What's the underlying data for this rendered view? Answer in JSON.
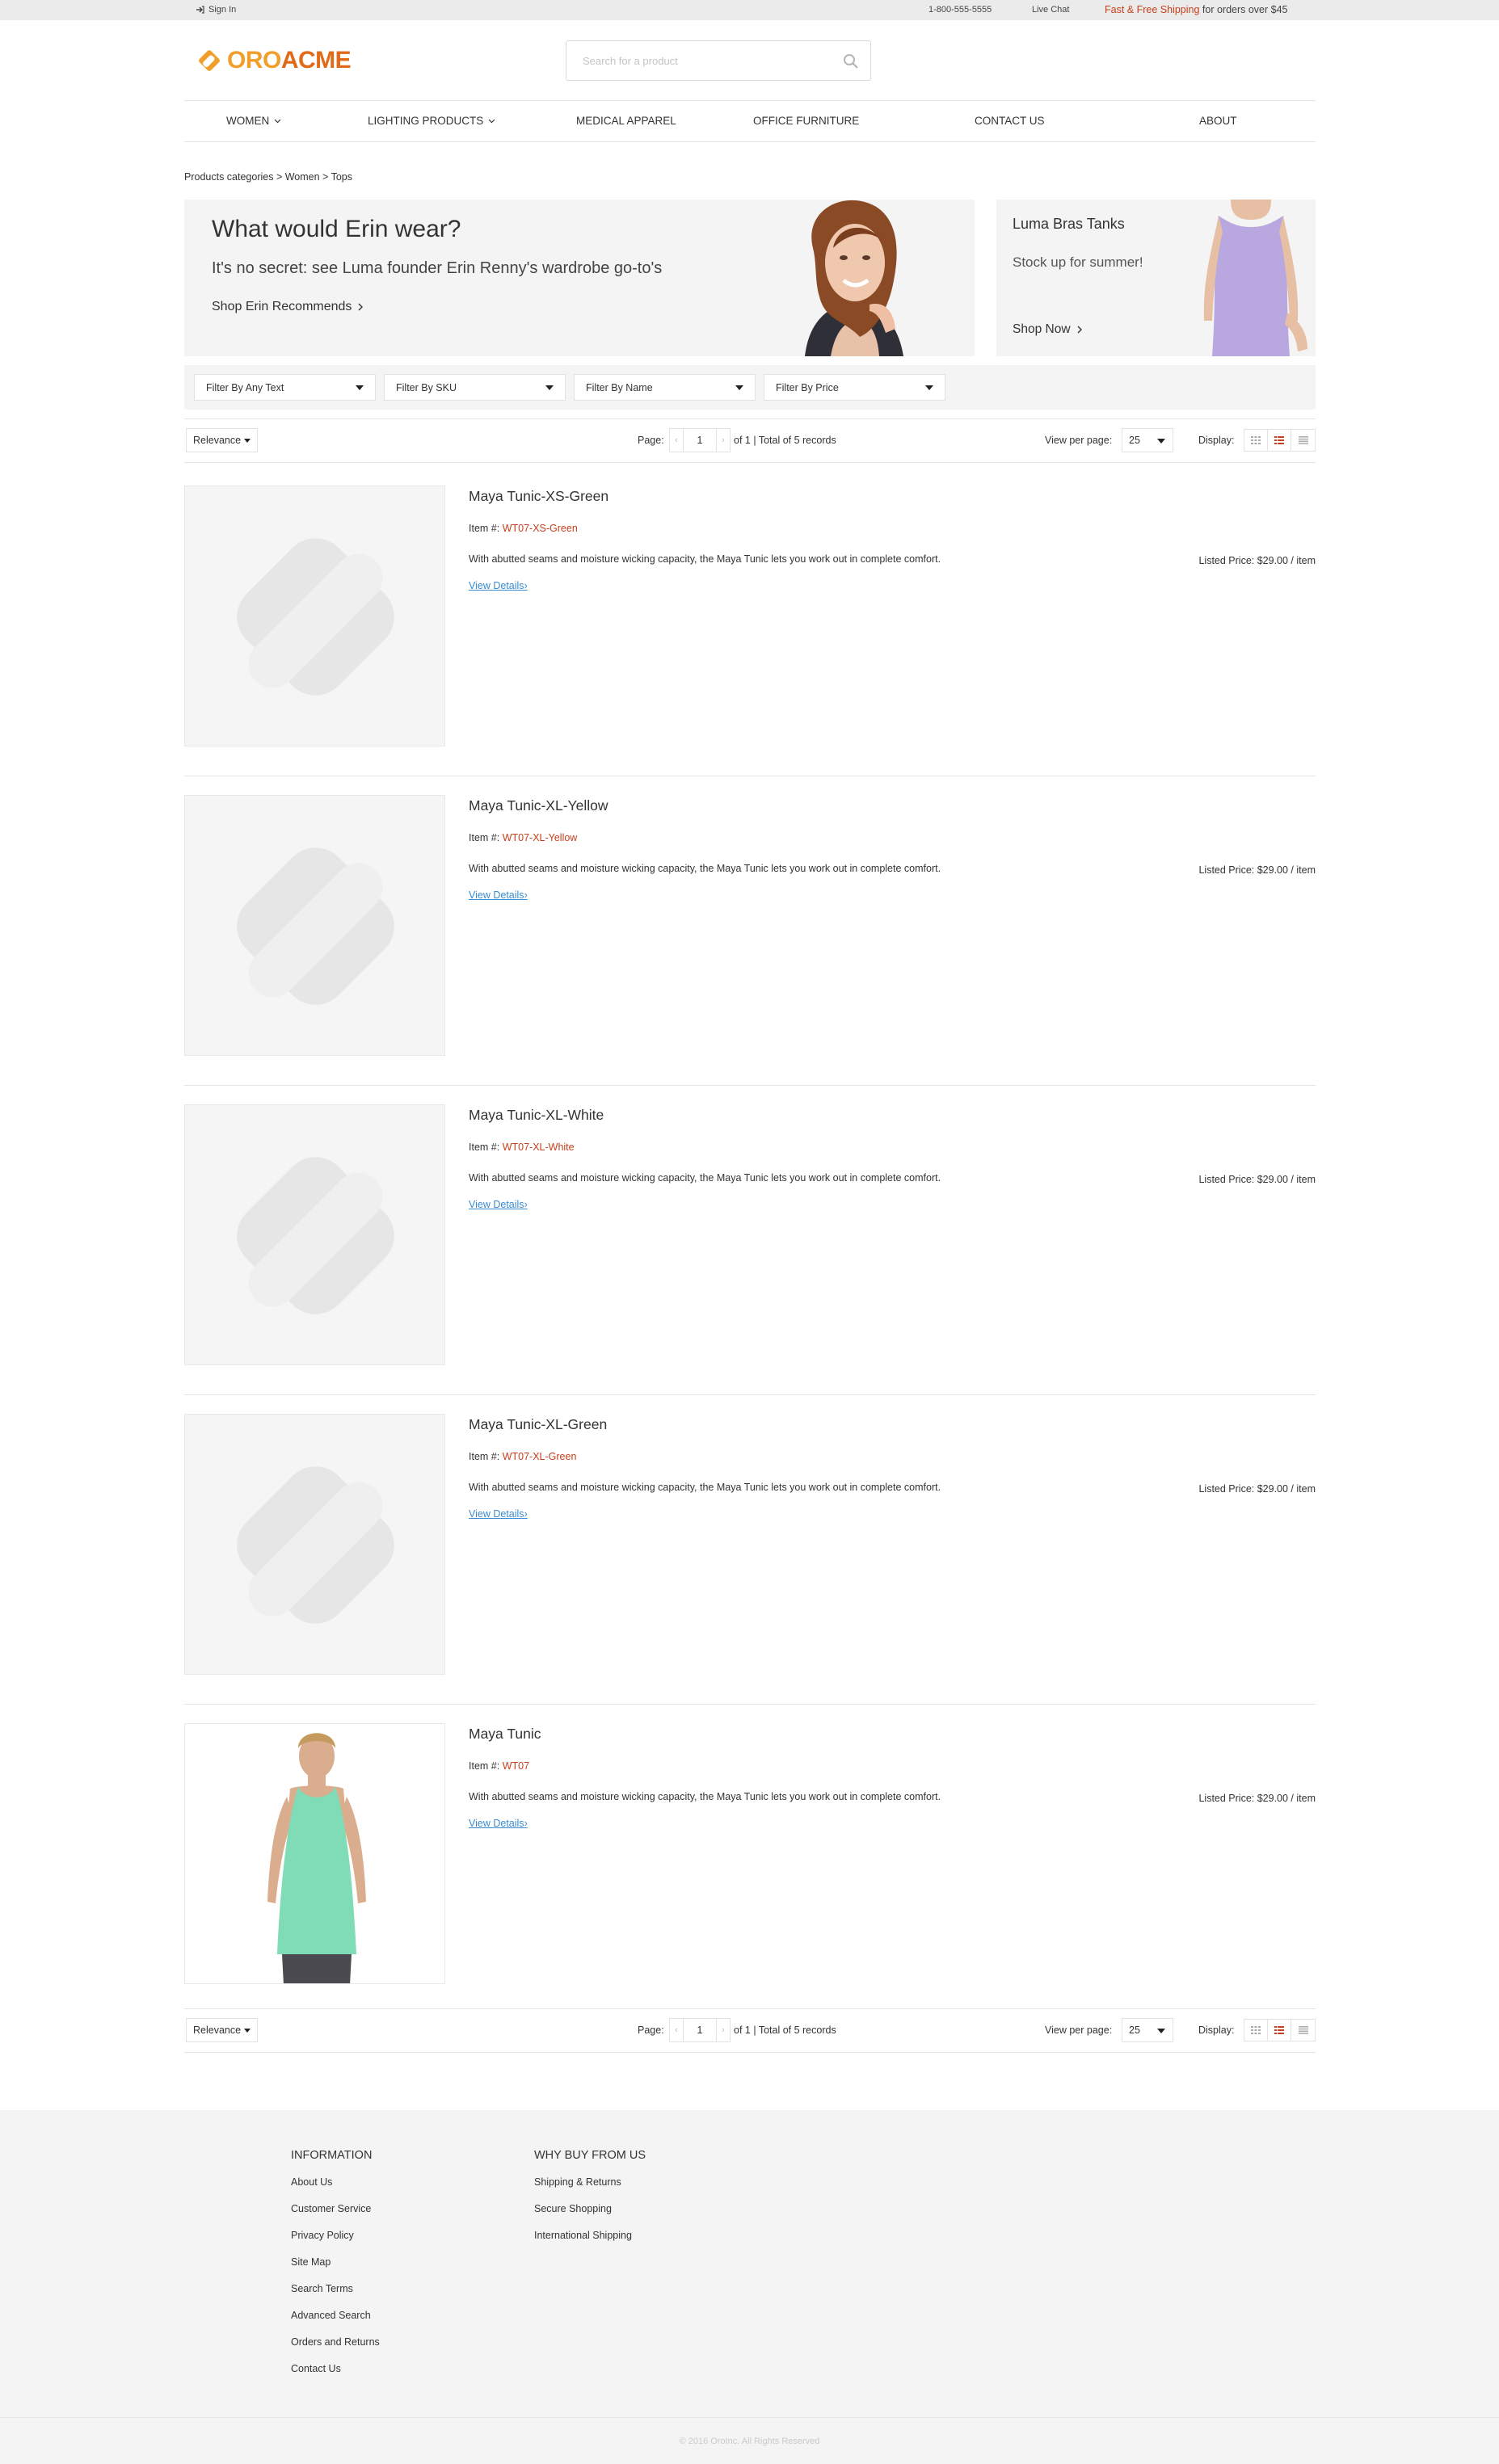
{
  "topbar": {
    "signin_label": "Sign In",
    "phone": "1-800-555-5555",
    "live_chat": "Live Chat",
    "shipping_accent": "Fast & Free Shipping",
    "shipping_rest": " for orders over $45"
  },
  "brand": {
    "logo_text_1": "ORO",
    "logo_text_2": "ACME",
    "accent": "#f0a02a",
    "accent_dark": "#e06a17"
  },
  "search": {
    "placeholder": "Search for a product",
    "icon": "search-icon"
  },
  "nav": {
    "items": [
      {
        "label": "WOMEN",
        "has_dropdown": true
      },
      {
        "label": "LIGHTING PRODUCTS",
        "has_dropdown": true
      },
      {
        "label": "MEDICAL APPAREL",
        "has_dropdown": false
      },
      {
        "label": "OFFICE FURNITURE",
        "has_dropdown": false
      },
      {
        "label": "CONTACT US",
        "has_dropdown": false
      },
      {
        "label": "ABOUT",
        "has_dropdown": false
      }
    ]
  },
  "breadcrumb": "Products categories > Women > Tops",
  "banners": {
    "primary": {
      "title": "What would Erin wear?",
      "subtitle": "It's no secret: see Luma founder Erin Renny's wardrobe go-to's",
      "cta": "Shop Erin Recommends"
    },
    "secondary": {
      "title": "Luma Bras Tanks",
      "subtitle": "Stock up for summer!",
      "cta": "Shop Now"
    }
  },
  "filters": [
    {
      "label": "Filter By Any Text"
    },
    {
      "label": "Filter By SKU"
    },
    {
      "label": "Filter By Name"
    },
    {
      "label": "Filter By Price"
    }
  ],
  "toolbar": {
    "sort_value": "Relevance",
    "page_label": "Page:",
    "prev": "‹",
    "current_page": "1",
    "next": "›",
    "total_text": "of 1 | Total of 5 records",
    "per_page_label": "View per page:",
    "per_page_value": "25",
    "display_label": "Display:",
    "active_view": "list",
    "active_color": "#c7401d"
  },
  "products": [
    {
      "name": "Maya Tunic-XS-Green",
      "sku_label": "Item #:",
      "sku": "WT07-XS-Green",
      "description": "With abutted seams and moisture wicking capacity, the Maya Tunic lets you work out in complete comfort.",
      "details_label": "View Details",
      "price_text": "Listed Price: $29.00 / item",
      "has_image": false
    },
    {
      "name": "Maya Tunic-XL-Yellow",
      "sku_label": "Item #:",
      "sku": "WT07-XL-Yellow",
      "description": "With abutted seams and moisture wicking capacity, the Maya Tunic lets you work out in complete comfort.",
      "details_label": "View Details",
      "price_text": "Listed Price: $29.00 / item",
      "has_image": false
    },
    {
      "name": "Maya Tunic-XL-White",
      "sku_label": "Item #:",
      "sku": "WT07-XL-White",
      "description": "With abutted seams and moisture wicking capacity, the Maya Tunic lets you work out in complete comfort.",
      "details_label": "View Details",
      "price_text": "Listed Price: $29.00 / item",
      "has_image": false
    },
    {
      "name": "Maya Tunic-XL-Green",
      "sku_label": "Item #:",
      "sku": "WT07-XL-Green",
      "description": "With abutted seams and moisture wicking capacity, the Maya Tunic lets you work out in complete comfort.",
      "details_label": "View Details",
      "price_text": "Listed Price: $29.00 / item",
      "has_image": false
    },
    {
      "name": "Maya Tunic",
      "sku_label": "Item #:",
      "sku": "WT07",
      "description": "With abutted seams and moisture wicking capacity, the Maya Tunic lets you work out in complete comfort.",
      "details_label": "View Details",
      "price_text": "Listed Price: $29.00 / item",
      "has_image": true
    }
  ],
  "footer": {
    "columns": [
      {
        "title": "INFORMATION",
        "links": [
          "About Us",
          "Customer Service",
          "Privacy Policy",
          "Site Map",
          "Search Terms",
          "Advanced Search",
          "Orders and Returns",
          "Contact Us"
        ]
      },
      {
        "title": "WHY BUY FROM US",
        "links": [
          "Shipping & Returns",
          "Secure Shopping",
          "International Shipping"
        ]
      }
    ],
    "copyright": "© 2016 OroInc. All Rights Reserved"
  }
}
